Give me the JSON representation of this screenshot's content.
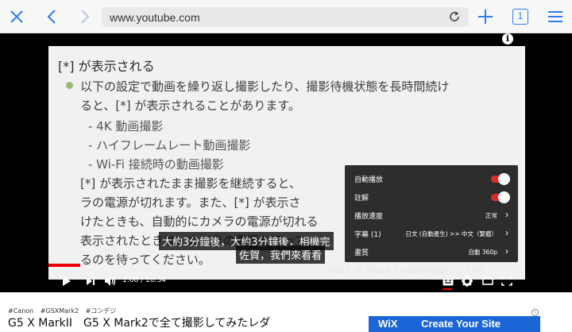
{
  "browser": {
    "url": "www.youtube.com",
    "tab_count": "1",
    "icons": [
      "close-icon",
      "back-icon",
      "forward-icon",
      "reload-icon",
      "new-tab-icon",
      "tabs-icon",
      "menu-icon"
    ]
  },
  "slide": {
    "heading": "[*] が表示される",
    "bullet_line1": "以下の設定で動画を繰り返し撮影したり、撮影待機状態を長時間続け",
    "bullet_line2": "ると、[*] が表示されることがあります。",
    "dash_items": [
      "- 4K 動画撮影",
      "- ハイフレームレート動画撮影",
      "- Wi-Fi 接続時の動画撮影"
    ],
    "para_lines": [
      "[*] が表示されたまま撮影を継続すると、",
      "ラの電源が切れます。また、[*] が表示さ",
      "けたときも、自動的にカメラの電源が切れる",
      "表示されたときは、カメラの電源を切って",
      "るのを待ってください。"
    ],
    "watermark": "※G5 X Mark2 WEB取説より引用"
  },
  "subtitles": {
    "line1": "大約3分鐘後，大約3分鐘後，相機完",
    "line2": "佐賀，我們來看看"
  },
  "settings_menu": {
    "autoplay_label": "自動播放",
    "annotations_label": "註解",
    "speed_label": "播放速度",
    "speed_value": "正常",
    "captions_label": "字幕 (1)",
    "captions_value": "日文 (自動產生) >> 中文（繁體）",
    "quality_label": "畫質",
    "quality_value": "自動 360p",
    "autoplay_on": true,
    "annotations_on": true
  },
  "controls": {
    "time": "1:08 / 10:34",
    "progress": 0.107
  },
  "below": {
    "tags": [
      "#Canon",
      "#GSXMark2",
      "#コンデジ"
    ],
    "title": "G5 X MarkII　G5 X Mark2で全て撮影してみたレダ",
    "ad_info": "i",
    "ad_text1": "WiX",
    "ad_text2": "Create Your Site"
  }
}
